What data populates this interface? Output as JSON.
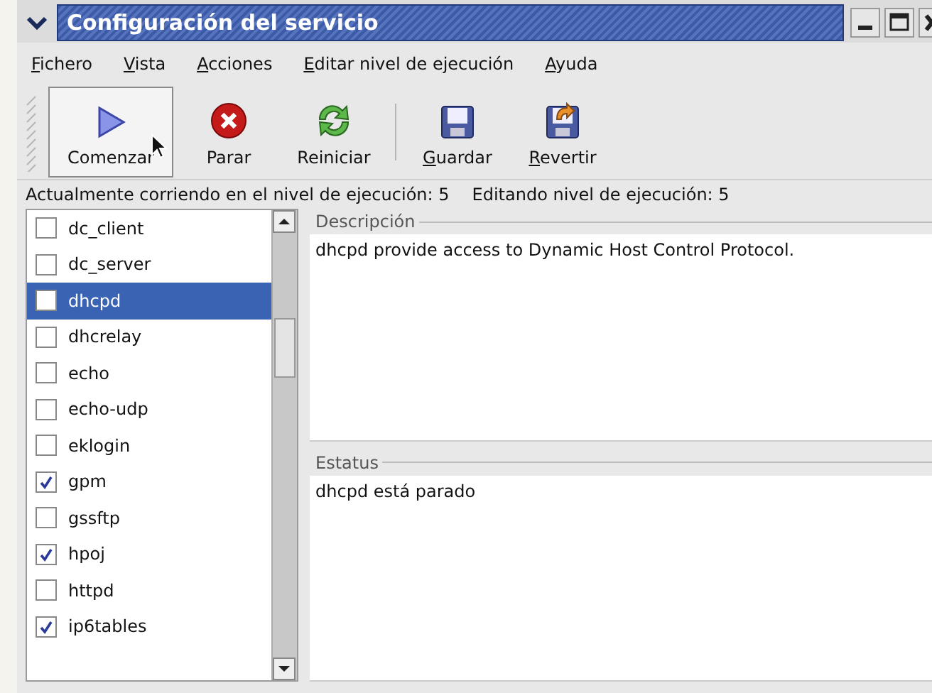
{
  "window": {
    "title": "Configuración del servicio"
  },
  "menu": [
    {
      "label": "Fichero",
      "mnemonic": true
    },
    {
      "label": "Vista",
      "mnemonic": true
    },
    {
      "label": "Acciones",
      "mnemonic": true
    },
    {
      "label": "Editar nivel de ejecución",
      "mnemonic": true
    },
    {
      "label": "Ayuda",
      "mnemonic": true
    }
  ],
  "toolbar": [
    {
      "kind": "start",
      "label": "Comenzar",
      "mnemonic": false,
      "hovered": true
    },
    {
      "kind": "stop",
      "label": "Parar",
      "mnemonic": false,
      "hovered": false
    },
    {
      "kind": "restart",
      "label": "Reiniciar",
      "mnemonic": false,
      "hovered": false
    },
    {
      "kind": "save",
      "label": "Guardar",
      "mnemonic": true,
      "hovered": false
    },
    {
      "kind": "revert",
      "label": "Revertir",
      "mnemonic": true,
      "hovered": false
    }
  ],
  "runlevel": {
    "current": "Actualmente corriendo en el nivel de ejecución: 5",
    "editing": "Editando nivel de ejecución: 5"
  },
  "services": [
    {
      "name": "dc_client",
      "checked": false,
      "selected": false
    },
    {
      "name": "dc_server",
      "checked": false,
      "selected": false
    },
    {
      "name": "dhcpd",
      "checked": false,
      "selected": true
    },
    {
      "name": "dhcrelay",
      "checked": false,
      "selected": false
    },
    {
      "name": "echo",
      "checked": false,
      "selected": false
    },
    {
      "name": "echo-udp",
      "checked": false,
      "selected": false
    },
    {
      "name": "eklogin",
      "checked": false,
      "selected": false
    },
    {
      "name": "gpm",
      "checked": true,
      "selected": false
    },
    {
      "name": "gssftp",
      "checked": false,
      "selected": false
    },
    {
      "name": "hpoj",
      "checked": true,
      "selected": false
    },
    {
      "name": "httpd",
      "checked": false,
      "selected": false
    },
    {
      "name": "ip6tables",
      "checked": true,
      "selected": false
    }
  ],
  "description": {
    "label": "Descripción",
    "text": "dhcpd provide access to Dynamic Host Control Protocol."
  },
  "status": {
    "label": "Estatus",
    "text": "dhcpd está parado"
  }
}
